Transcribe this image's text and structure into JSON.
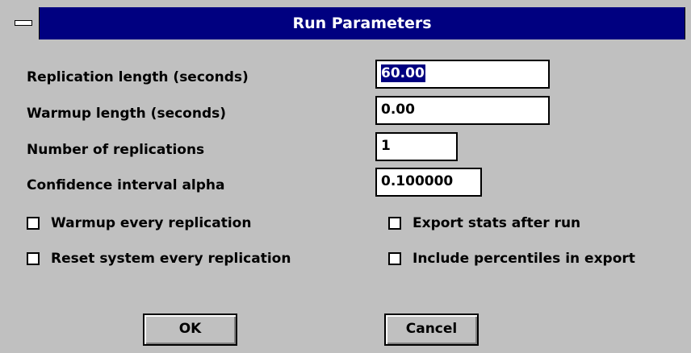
{
  "window": {
    "title": "Run Parameters",
    "system_menu_icon": "minus-bar-icon"
  },
  "fields": [
    {
      "label": "Replication length (seconds)",
      "value": "60.00",
      "selected": true
    },
    {
      "label": "Warmup length (seconds)",
      "value": "0.00",
      "selected": false
    },
    {
      "label": "Number of replications",
      "value": "1",
      "selected": false
    },
    {
      "label": "Confidence interval alpha",
      "value": "0.100000",
      "selected": false
    }
  ],
  "checkboxes": [
    {
      "label": "Warmup every replication",
      "checked": false
    },
    {
      "label": "Export stats after run",
      "checked": false
    },
    {
      "label": "Reset system every replication",
      "checked": false
    },
    {
      "label": "Include percentiles in export",
      "checked": false
    }
  ],
  "buttons": {
    "ok": "OK",
    "cancel": "Cancel"
  },
  "colors": {
    "title_bar": "#000080",
    "dialog_face": "#c0c0c0",
    "selection": "#000080"
  }
}
